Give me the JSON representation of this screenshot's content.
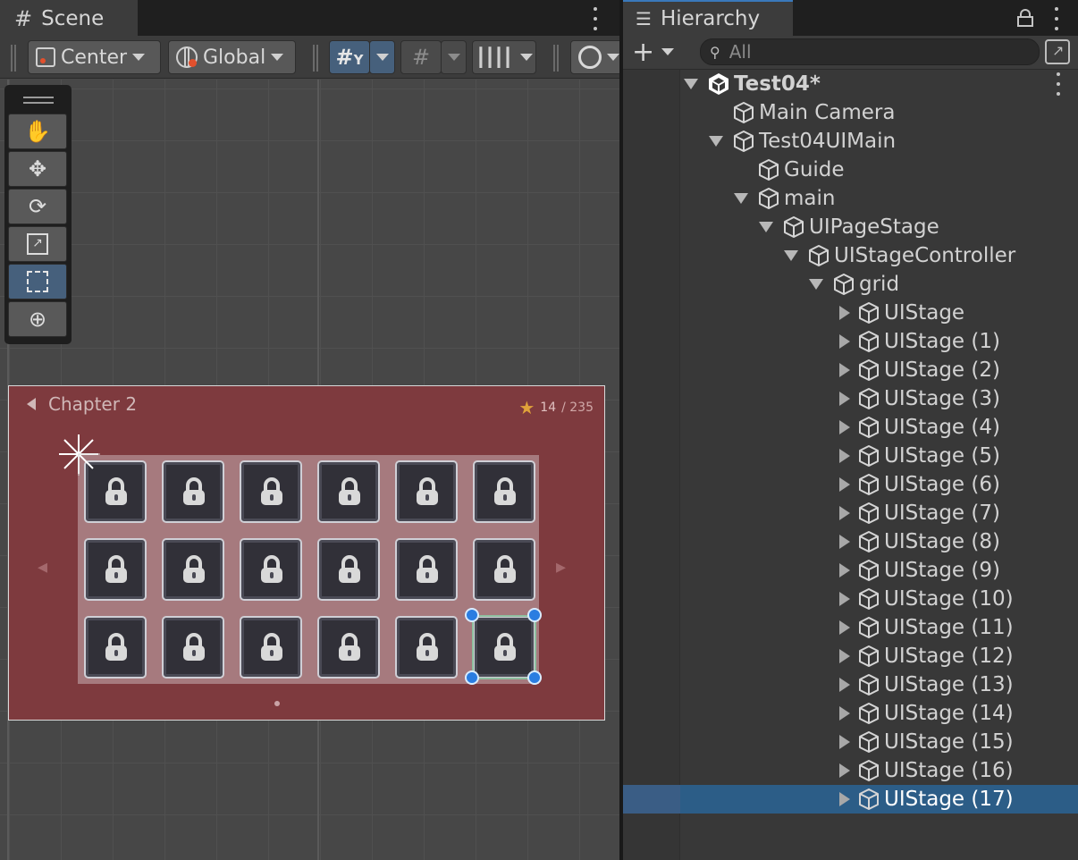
{
  "scene": {
    "tab_title": "Scene",
    "toolbar": {
      "pivot_mode": "Center",
      "pivot_rotation": "Global"
    },
    "canvas": {
      "chapter_title": "Chapter 2",
      "stars_earned": "14",
      "stars_total": "/ 235",
      "grid": {
        "rows": 3,
        "columns": 6,
        "locked_stages": 18,
        "selected_stage_index": 17
      }
    }
  },
  "hierarchy": {
    "tab_title": "Hierarchy",
    "search_placeholder": "All",
    "tree": [
      {
        "label": "Test04*",
        "depth": 0,
        "fold": "open",
        "icon": "unity-scene-icon"
      },
      {
        "label": "Main Camera",
        "depth": 1,
        "fold": "none",
        "icon": "gameobject-cube-icon"
      },
      {
        "label": "Test04UIMain",
        "depth": 1,
        "fold": "open",
        "icon": "gameobject-cube-icon"
      },
      {
        "label": "Guide",
        "depth": 2,
        "fold": "none",
        "icon": "gameobject-cube-icon"
      },
      {
        "label": "main",
        "depth": 2,
        "fold": "open",
        "icon": "gameobject-cube-icon"
      },
      {
        "label": "UIPageStage",
        "depth": 3,
        "fold": "open",
        "icon": "gameobject-cube-icon"
      },
      {
        "label": "UIStageController",
        "depth": 4,
        "fold": "open",
        "icon": "gameobject-cube-icon"
      },
      {
        "label": "grid",
        "depth": 5,
        "fold": "open",
        "icon": "gameobject-cube-icon"
      },
      {
        "label": "UIStage",
        "depth": 6,
        "fold": "closed",
        "icon": "gameobject-cube-icon"
      },
      {
        "label": "UIStage (1)",
        "depth": 6,
        "fold": "closed",
        "icon": "gameobject-cube-icon"
      },
      {
        "label": "UIStage (2)",
        "depth": 6,
        "fold": "closed",
        "icon": "gameobject-cube-icon"
      },
      {
        "label": "UIStage (3)",
        "depth": 6,
        "fold": "closed",
        "icon": "gameobject-cube-icon"
      },
      {
        "label": "UIStage (4)",
        "depth": 6,
        "fold": "closed",
        "icon": "gameobject-cube-icon"
      },
      {
        "label": "UIStage (5)",
        "depth": 6,
        "fold": "closed",
        "icon": "gameobject-cube-icon"
      },
      {
        "label": "UIStage (6)",
        "depth": 6,
        "fold": "closed",
        "icon": "gameobject-cube-icon"
      },
      {
        "label": "UIStage (7)",
        "depth": 6,
        "fold": "closed",
        "icon": "gameobject-cube-icon"
      },
      {
        "label": "UIStage (8)",
        "depth": 6,
        "fold": "closed",
        "icon": "gameobject-cube-icon"
      },
      {
        "label": "UIStage (9)",
        "depth": 6,
        "fold": "closed",
        "icon": "gameobject-cube-icon"
      },
      {
        "label": "UIStage (10)",
        "depth": 6,
        "fold": "closed",
        "icon": "gameobject-cube-icon"
      },
      {
        "label": "UIStage (11)",
        "depth": 6,
        "fold": "closed",
        "icon": "gameobject-cube-icon"
      },
      {
        "label": "UIStage (12)",
        "depth": 6,
        "fold": "closed",
        "icon": "gameobject-cube-icon"
      },
      {
        "label": "UIStage (13)",
        "depth": 6,
        "fold": "closed",
        "icon": "gameobject-cube-icon"
      },
      {
        "label": "UIStage (14)",
        "depth": 6,
        "fold": "closed",
        "icon": "gameobject-cube-icon"
      },
      {
        "label": "UIStage (15)",
        "depth": 6,
        "fold": "closed",
        "icon": "gameobject-cube-icon"
      },
      {
        "label": "UIStage (16)",
        "depth": 6,
        "fold": "closed",
        "icon": "gameobject-cube-icon"
      },
      {
        "label": "UIStage (17)",
        "depth": 6,
        "fold": "closed",
        "icon": "gameobject-cube-icon",
        "selected": true
      }
    ]
  },
  "colors": {
    "selection": "#2c5d87",
    "canvas_bg": "#7e3a3e",
    "handle": "#2a7de1",
    "active_tool": "#46607c"
  }
}
